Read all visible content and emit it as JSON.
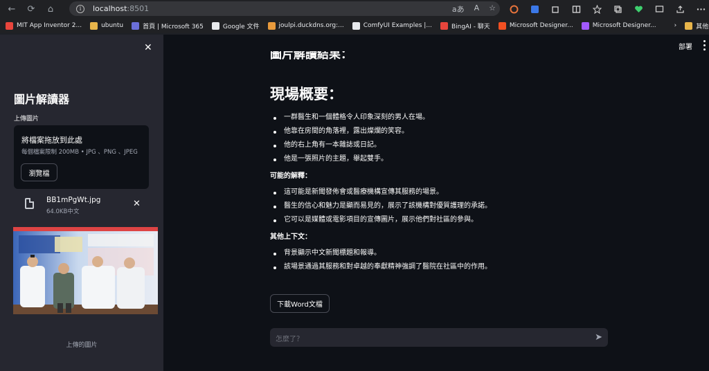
{
  "browser": {
    "nav": {
      "back": "←",
      "reload": "⟳",
      "home": "⌂"
    },
    "url": {
      "host": "localhost",
      "port": ":8501"
    },
    "omnibox_icons": [
      "aあ",
      "A",
      "☆"
    ],
    "bookmarks": [
      {
        "label": "MIT App Inventor 2...",
        "color": "#e8453c"
      },
      {
        "label": "ubuntu",
        "color": "#e8b54a"
      },
      {
        "label": "首頁 | Microsoft 365",
        "color": "#6b6fd9"
      },
      {
        "label": "Google 文件",
        "color": "#e8eaed"
      },
      {
        "label": "joulpi.duckdns.org:...",
        "color": "#e89a3c"
      },
      {
        "label": "ComfyUI Examples |...",
        "color": "#e8eaed"
      },
      {
        "label": "BingAI - 聊天",
        "color": "#e8453c"
      },
      {
        "label": "Microsoft Designer...",
        "color": "#f25022"
      },
      {
        "label": "Microsoft Designer...",
        "color": "#a259ff"
      }
    ],
    "bookmarks_overflow": "›",
    "other_bookmarks": "其他 [我的最愛]"
  },
  "sidebar": {
    "close": "✕",
    "title": "圖片解讀器",
    "upload_label": "上傳圖片",
    "dropzone": {
      "main": "將檔案拖放到此處",
      "limit": "每個檔案限制 200MB • JPG 、PNG 、JPEG",
      "browse": "瀏覽檔"
    },
    "file": {
      "name": "BB1mPgWt.jpg",
      "size": "64.0KB中文",
      "remove": "✕"
    },
    "image_caption": "上傳的圖片"
  },
  "main": {
    "deploy": "部署",
    "cut_heading": "圖片解讀結果：",
    "heading": "現場概要：",
    "overview": [
      "一群醫生和一個體格令人印象深刻的男人在場。",
      "他靠在房間的角落裡，露出燦爛的笑容。",
      "他的右上角有一本雜誌或日記。",
      "他是一張照片的主題，舉起雙手。"
    ],
    "possible_title": "可能的解釋：",
    "possible": [
      "這可能是新聞發佈會或醫療機構宣傳其服務的場景。",
      "醫生的信心和魅力是顯而易見的，展示了該機構對優質護理的承諾。",
      "它可以是媒體或電影項目的宣傳圖片，展示他們對社區的參與。"
    ],
    "context_title": "其他上下文：",
    "context": [
      "背景顯示中文新聞標題和報導。",
      "該場景通過其服務和對卓越的奉獻精神強調了醫院在社區中的作用。"
    ],
    "download_button": "下載Word文檔",
    "chat_placeholder": "怎麼了？",
    "send": "➤"
  }
}
